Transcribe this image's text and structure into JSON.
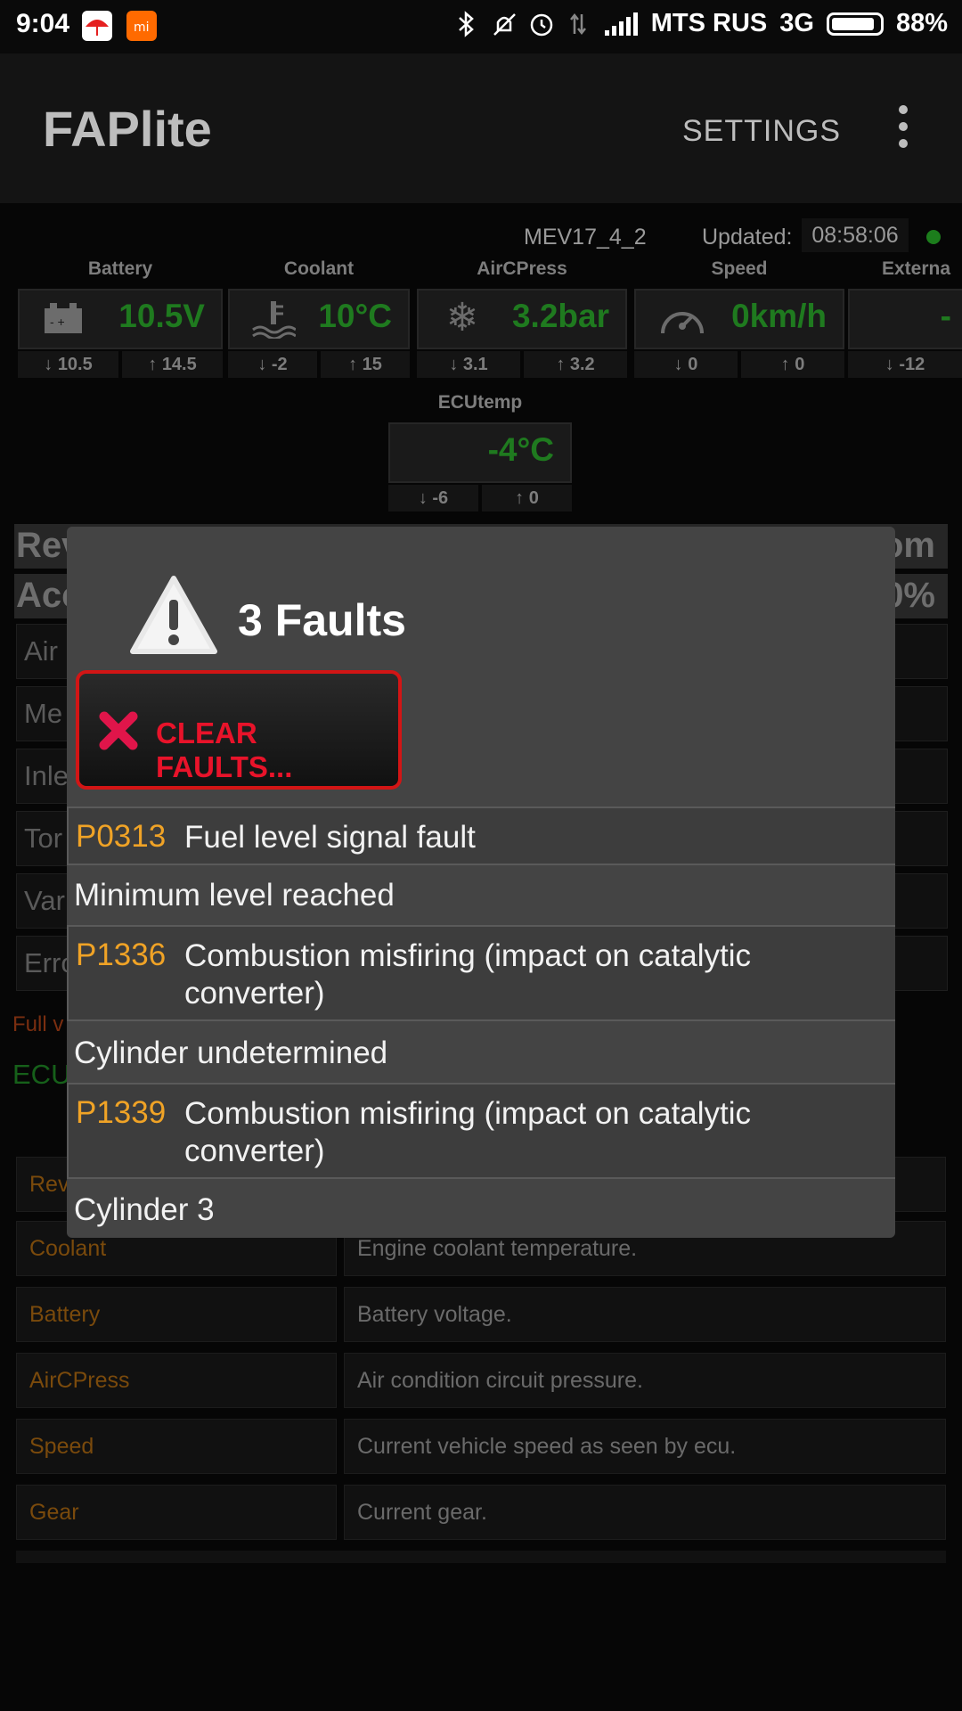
{
  "status_bar": {
    "time": "9:04",
    "carrier": "MTS RUS",
    "network": "3G",
    "battery": "88%",
    "icons": [
      "umbrella-app-icon",
      "mi-app-icon",
      "bluetooth-icon",
      "mute-icon",
      "alarm-icon",
      "data-icon",
      "signal-icon",
      "battery-icon"
    ]
  },
  "app_bar": {
    "title": "FAPlite",
    "settings_label": "SETTINGS"
  },
  "header": {
    "ecu_id": "MEV17_4_2",
    "updated_label": "Updated:",
    "updated_time": "08:58:06"
  },
  "gauges": [
    {
      "label": "Battery",
      "value": "10.5V",
      "min": "10.5",
      "max": "14.5",
      "icon": "battery-icon"
    },
    {
      "label": "Coolant",
      "value": "10°C",
      "min": "-2",
      "max": "15",
      "icon": "coolant-temp-icon"
    },
    {
      "label": "AirCPress",
      "value": "3.2bar",
      "min": "3.1",
      "max": "3.2",
      "icon": "snowflake-icon"
    },
    {
      "label": "Speed",
      "value": "0km/h",
      "min": "0",
      "max": "0",
      "icon": "speedometer-icon"
    },
    {
      "label": "Externa",
      "value": "-",
      "min": "-12",
      "max": "",
      "icon": ""
    }
  ],
  "ecu_temp": {
    "label": "ECUtemp",
    "value": "-4°C",
    "min": "-6",
    "max": "0"
  },
  "background": {
    "rows": [
      {
        "left": "Rev",
        "right": "om"
      },
      {
        "left": "Acc",
        "right": "0%"
      }
    ],
    "list": [
      "Air",
      "Me",
      "Inle",
      "Tor",
      "Var",
      "Erro"
    ],
    "full_v": "Full v",
    "ecu_g": "ECU",
    "desc_rows": [
      {
        "key": "Rev",
        "value": ""
      },
      {
        "key": "Coolant",
        "value": "Engine coolant temperature."
      },
      {
        "key": "Battery",
        "value": "Battery voltage."
      },
      {
        "key": "AirCPress",
        "value": "Air condition circuit pressure."
      },
      {
        "key": "Speed",
        "value": "Current vehicle speed as seen by ecu."
      },
      {
        "key": "Gear",
        "value": "Current gear."
      }
    ]
  },
  "dialog": {
    "title": "3 Faults",
    "clear_label": "CLEAR FAULTS...",
    "faults": [
      {
        "code": "P0313",
        "desc": "Fuel level signal fault",
        "detail": "Minimum level reached"
      },
      {
        "code": "P1336",
        "desc": "Combustion misfiring (impact on catalytic converter)",
        "detail": "Cylinder undetermined"
      },
      {
        "code": "P1339",
        "desc": "Combustion misfiring (impact on catalytic converter)",
        "detail": "Cylinder 3"
      }
    ]
  },
  "colors": {
    "accent_green": "#1f7a1f",
    "fault_code": "#f0a326",
    "clear_red": "#e8132a"
  }
}
